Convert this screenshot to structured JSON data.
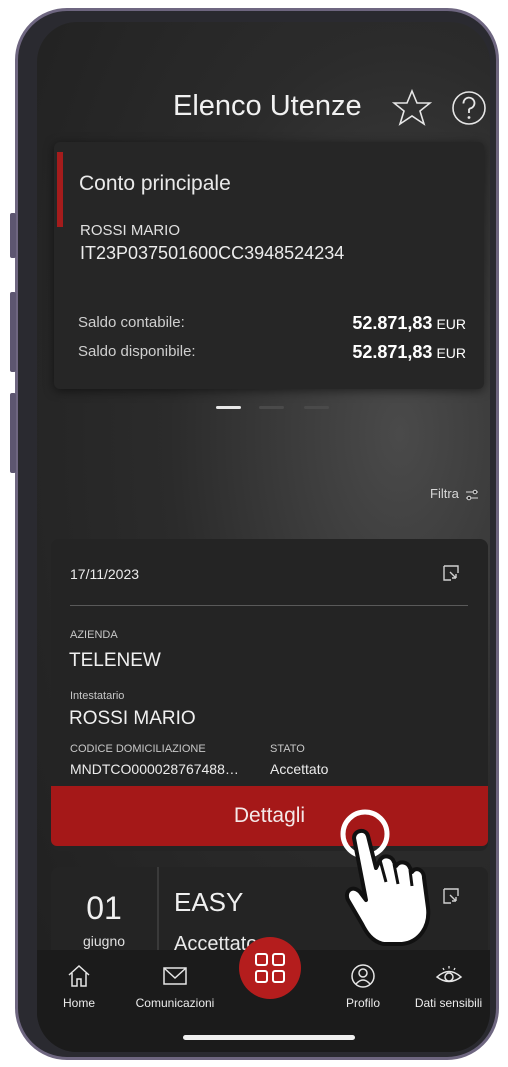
{
  "header": {
    "title": "Elenco Utenze"
  },
  "account": {
    "title": "Conto principale",
    "holder": "ROSSI MARIO",
    "iban": "IT23P037501600CC3948524234",
    "saldo_contabile_label": "Saldo contabile:",
    "saldo_contabile_value": "52.871,83",
    "saldo_disponibile_label": "Saldo disponibile:",
    "saldo_disponibile_value": "52.871,83",
    "currency": "EUR"
  },
  "filter_label": "Filtra",
  "item": {
    "date": "17/11/2023",
    "azienda_label": "AZIENDA",
    "azienda_value": "TELENEW",
    "intestatario_label": "Intestatario",
    "intestatario_value": "ROSSI MARIO",
    "codice_label": "CODICE DOMICILIAZIONE",
    "codice_value": "MNDTCO000028767488…",
    "stato_label": "STATO",
    "stato_value": "Accettato",
    "details_button": "Dettagli"
  },
  "item2": {
    "day": "01",
    "month": "giugno",
    "title": "EASY",
    "status": "Accettato"
  },
  "tabs": [
    {
      "label": "Home",
      "icon": "home-icon"
    },
    {
      "label": "Comunicazioni",
      "icon": "mail-icon"
    },
    {
      "label": "",
      "icon": "grid-icon"
    },
    {
      "label": "Profilo",
      "icon": "profile-icon"
    },
    {
      "label": "Dati sensibili",
      "icon": "eye-icon"
    }
  ],
  "colors": {
    "accent": "#a51818",
    "background": "#2b2b2b",
    "card": "#262626"
  }
}
